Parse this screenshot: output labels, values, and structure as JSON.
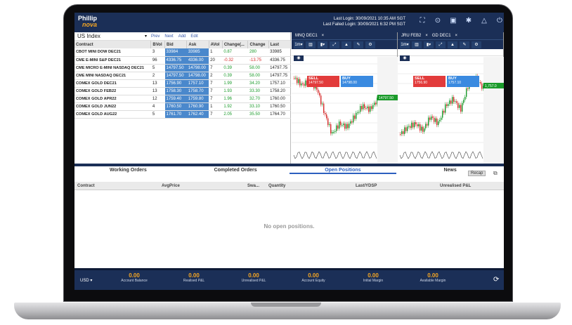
{
  "header": {
    "logo_top": "Phillip",
    "logo_bottom": "nova",
    "last_login": "Last Login: 30/09/2021 10:35 AM SGT",
    "last_failed": "Last Failed Login: 30/09/2021 6:32 PM SGT"
  },
  "watchlist": {
    "index_select": "US Index",
    "actions": [
      "Prev",
      "Next",
      "Add",
      "Edit"
    ],
    "columns": [
      "Contract",
      "BVol",
      "Bid",
      "Ask",
      "AVol",
      "Change(...",
      "Change",
      "Last"
    ],
    "rows": [
      [
        "CBOT MINI DOW DEC21",
        "3",
        "33984",
        "33985",
        "1",
        "0.87",
        "280",
        "33985"
      ],
      [
        "CME E-MINI S&P DEC21",
        "96",
        "4336.75",
        "4336.00",
        "20",
        "-0.32",
        "-13.75",
        "4336.75"
      ],
      [
        "CME MICRO E-MINI NASDAQ DEC21",
        "5",
        "14797.50",
        "14798.00",
        "7",
        "0.39",
        "58.00",
        "14797.75"
      ],
      [
        "CME MINI NASDAQ DEC21",
        "2",
        "14797.50",
        "14798.00",
        "2",
        "0.39",
        "58.00",
        "14797.75"
      ],
      [
        "COMEX GOLD DEC21",
        "13",
        "1756.90",
        "1757.10",
        "7",
        "1.99",
        "34.20",
        "1757.10"
      ],
      [
        "COMEX GOLD FEB22",
        "13",
        "1758.30",
        "1758.70",
        "7",
        "1.93",
        "33.30",
        "1758.20"
      ],
      [
        "COMEX GOLD APR22",
        "12",
        "1759.40",
        "1759.80",
        "7",
        "1.96",
        "32.70",
        "1760.00"
      ],
      [
        "COMEX GOLD JUN22",
        "4",
        "1760.50",
        "1760.90",
        "1",
        "1.92",
        "33.10",
        "1760.50"
      ],
      [
        "COMEX GOLD AUG22",
        "5",
        "1761.70",
        "1762.40",
        "7",
        "2.05",
        "35.50",
        "1764.70"
      ]
    ]
  },
  "charts": [
    {
      "tab": "MNQ DEC1",
      "sell": "SELL",
      "sell_price": "14797.50",
      "buy": "BUY",
      "buy_price": "14798.00",
      "last_tag": "14797.50"
    },
    {
      "tab": "JRU FEB2",
      "tab2": "GD DEC1",
      "sell": "SELL",
      "sell_price": "1756.90",
      "buy": "BUY",
      "buy_price": "1757.10",
      "last_tag": "1,757.0"
    }
  ],
  "orders": {
    "tabs": [
      "Working Orders",
      "Completed Orders",
      "Open Positions",
      "News"
    ],
    "active_tab": "Open Positions",
    "recap": "Recap",
    "columns": [
      "Contract",
      "AvgPrice",
      "Swa...",
      "Quantity",
      "Last/YDSP",
      "Unrealised P&L"
    ],
    "empty_message": "No open positions."
  },
  "footer": {
    "currency": "USD",
    "items": [
      {
        "value": "0.00",
        "label": "Account Balance"
      },
      {
        "value": "0.00",
        "label": "Realised P&L"
      },
      {
        "value": "0.00",
        "label": "Unrealised P&L"
      },
      {
        "value": "0.00",
        "label": "Account Equity"
      },
      {
        "value": "0.00",
        "label": "Initial Margin"
      },
      {
        "value": "0.00",
        "label": "Available Margin"
      }
    ]
  },
  "colors": {
    "navy": "#1b2f57",
    "accent": "#f5a623",
    "bid_bg": "#4a88cc",
    "up": "#1a9a2a",
    "down": "#d52a2a"
  }
}
